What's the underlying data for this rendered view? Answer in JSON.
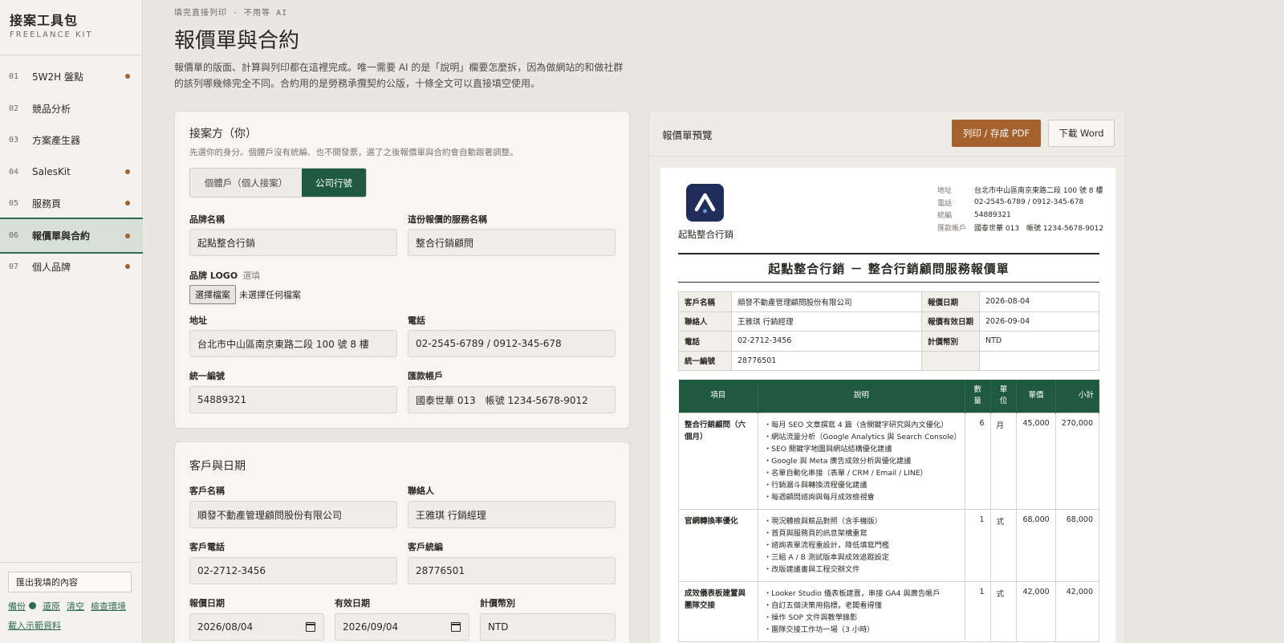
{
  "sidebar": {
    "brand_title": "接案工具包",
    "brand_sub": "FREELANCE KIT",
    "items": [
      {
        "num": "01",
        "label": "5W2H 盤點",
        "dot": true
      },
      {
        "num": "02",
        "label": "競品分析",
        "dot": false
      },
      {
        "num": "03",
        "label": "方案產生器",
        "dot": false
      },
      {
        "num": "04",
        "label": "SalesKit",
        "dot": true
      },
      {
        "num": "05",
        "label": "服務頁",
        "dot": true
      },
      {
        "num": "06",
        "label": "報價單與合約",
        "dot": true
      },
      {
        "num": "07",
        "label": "個人品牌",
        "dot": true
      }
    ],
    "export_label": "匯出我填的內容",
    "backup_label": "備份",
    "restore_label": "還原",
    "clear_label": "清空",
    "check_label": "檢查環境",
    "demo_label": "載入示範資料"
  },
  "header": {
    "eyebrow": "填完直接列印 · 不用等 AI",
    "title": "報價單與合約",
    "desc": "報價單的版面、計算與列印都在這裡完成。唯一需要 AI 的是「說明」欄要怎麼拆，因為做網站的和做社群的該列哪幾條完全不同。合約用的是勞務承攬契約公版，十條全文可以直接填空使用。"
  },
  "vendor_card": {
    "title": "接案方（你）",
    "hint": "先選你的身分。個體戶沒有統編、也不開發票，選了之後報價單與合約會自動跟著調整。",
    "seg_individual": "個體戶（個人接案）",
    "seg_company": "公司行號",
    "brand_name_label": "品牌名稱",
    "brand_name_value": "起點整合行銷",
    "service_name_label": "這份報價的服務名稱",
    "service_name_value": "整合行銷顧問",
    "logo_label": "品牌 LOGO",
    "logo_optional": "選填",
    "file_button": "選擇檔案",
    "file_status": "未選擇任何檔案",
    "address_label": "地址",
    "address_value": "台北市中山區南京東路二段 100 號 8 樓",
    "phone_label": "電話",
    "phone_value": "02-2545-6789 / 0912-345-678",
    "tax_id_label": "統一編號",
    "tax_id_value": "54889321",
    "bank_label": "匯款帳戶",
    "bank_value": "國泰世華 013　帳號 1234-5678-9012"
  },
  "client_card": {
    "title": "客戶與日期",
    "client_name_label": "客戶名稱",
    "client_name_value": "順發不動產管理顧問股份有限公司",
    "contact_label": "聯絡人",
    "contact_value": "王雅琪 行銷經理",
    "client_phone_label": "客戶電話",
    "client_phone_value": "02-2712-3456",
    "client_tax_label": "客戶統編",
    "client_tax_value": "28776501",
    "quote_date_label": "報價日期",
    "quote_date_value": "2026/08/04",
    "valid_date_label": "有效日期",
    "valid_date_value": "2026/09/04",
    "currency_label": "計價幣別",
    "currency_value": "NTD"
  },
  "preview": {
    "title": "報價單預覽",
    "print_button": "列印 / 存成 PDF",
    "word_button": "下載 Word",
    "company_name": "起點整合行銷",
    "info": [
      {
        "k": "地址",
        "v": "台北市中山區南京東路二段 100 號 8 樓"
      },
      {
        "k": "電話",
        "v": "02-2545-6789 / 0912-345-678"
      },
      {
        "k": "統編",
        "v": "54889321"
      },
      {
        "k": "匯款帳戶",
        "v": "國泰世華 013　帳號 1234-5678-9012"
      }
    ],
    "doc_title": "起點整合行銷 － 整合行銷顧問服務報價單",
    "meta": {
      "client_k": "客戶名稱",
      "client_v": "順發不動產管理顧問股份有限公司",
      "date_k": "報價日期",
      "date_v": "2026-08-04",
      "contact_k": "聯絡人",
      "contact_v": "王雅琪 行銷經理",
      "valid_k": "報價有效日期",
      "valid_v": "2026-09-04",
      "phone_k": "電話",
      "phone_v": "02-2712-3456",
      "currency_k": "計價幣別",
      "currency_v": "NTD",
      "tax_k": "統一編號",
      "tax_v": "28776501"
    },
    "columns": {
      "item": "項目",
      "desc": "說明",
      "qty": "數量",
      "unit": "單位",
      "price": "單價",
      "subtotal": "小計"
    },
    "items": [
      {
        "name": "整合行銷顧問（六個月）",
        "desc": [
          "・每月 SEO 文章撰寫 4 篇（含關鍵字研究與內文優化）",
          "・網站流量分析（Google Analytics 與 Search Console）",
          "・SEO 關鍵字地圖與網站結構優化建議",
          "・Google 與 Meta 廣告成效分析與優化建議",
          "・名單自動化串接（表單 / CRM / Email / LINE）",
          "・行銷漏斗與轉換流程優化建議",
          "・每週顧問諮詢與每月成效檢視會"
        ],
        "qty": "6",
        "unit": "月",
        "price": "45,000",
        "subtotal": "270,000"
      },
      {
        "name": "官網轉換率優化",
        "desc": [
          "・現況體檢與競品對照（含手機版）",
          "・首頁與服務頁的訊息架構重寫",
          "・諮詢表單流程重設計，降低填寫門檻",
          "・三組 A / B 測試版本與成效追蹤設定",
          "・改版建議書與工程交辦文件"
        ],
        "qty": "1",
        "unit": "式",
        "price": "68,000",
        "subtotal": "68,000"
      },
      {
        "name": "成效儀表板建置與團隊交接",
        "desc": [
          "・Looker Studio 儀表板建置，串接 GA4 與廣告帳戶",
          "・自訂五個決策用指標，老闆看得懂",
          "・操作 SOP 文件與教學錄影",
          "・團隊交接工作坊一場（3 小時）"
        ],
        "qty": "1",
        "unit": "式",
        "price": "42,000",
        "subtotal": "42,000"
      }
    ]
  }
}
